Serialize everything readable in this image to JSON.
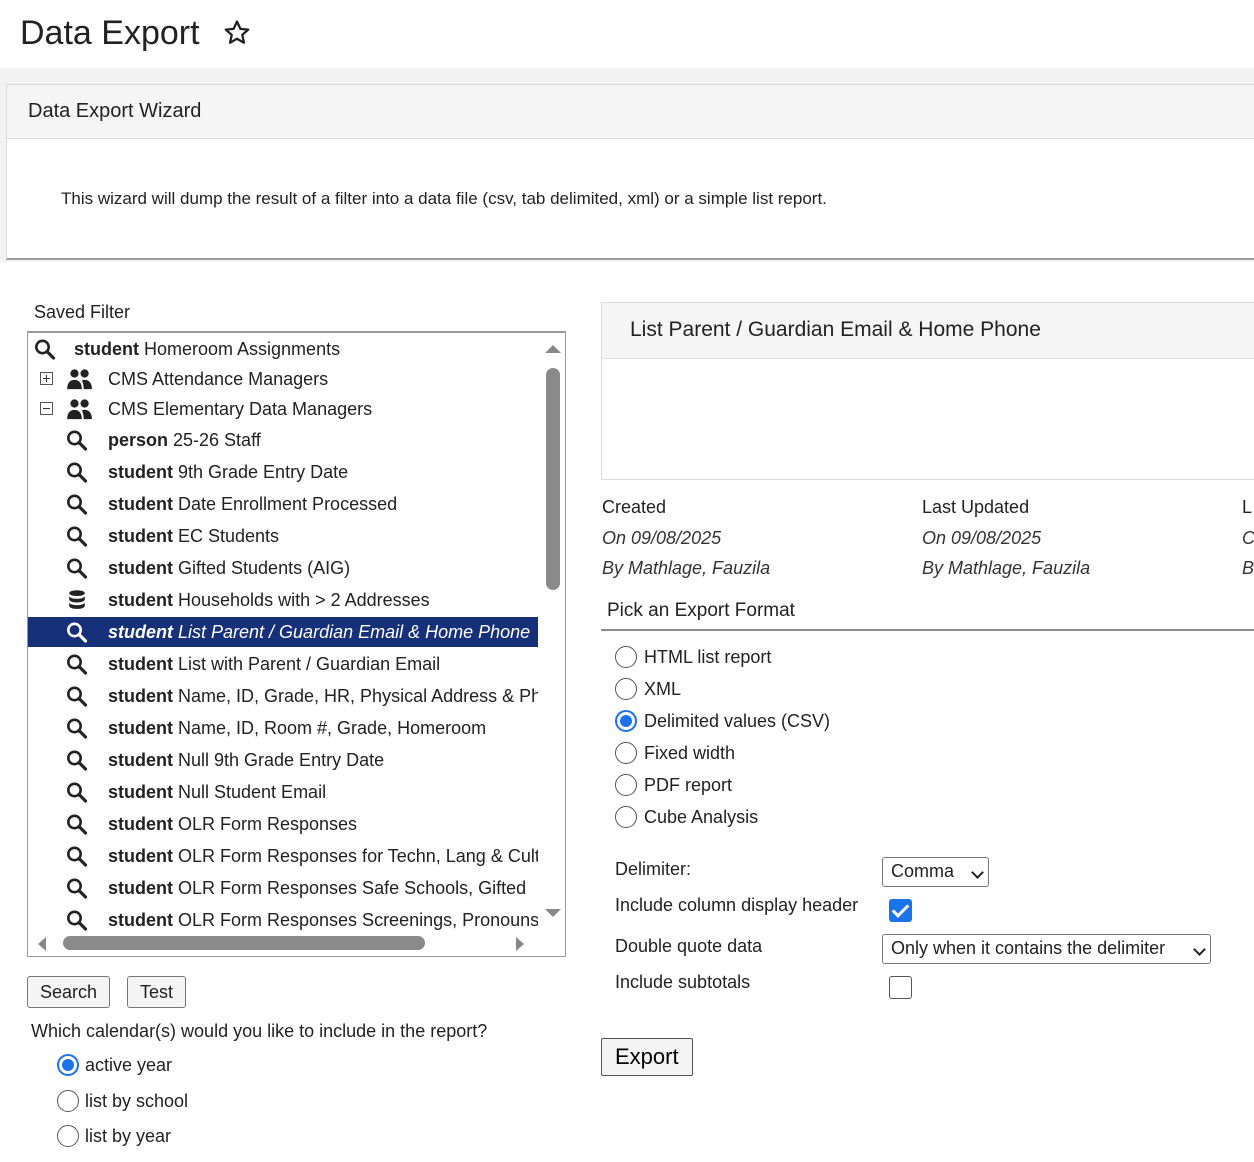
{
  "header": {
    "title": "Data Export"
  },
  "wizard": {
    "title": "Data Export Wizard",
    "description": "This wizard will dump the result of a filter into a data file (csv, tab delimited, xml) or a simple list report."
  },
  "saved_filter": {
    "label": "Saved Filter",
    "items": [
      {
        "prefix": "student",
        "name": " Homeroom Assignments",
        "icon": "search-icon"
      },
      {
        "prefix": "",
        "name": "CMS Attendance Managers",
        "icon": "users-icon",
        "expander": "plus"
      },
      {
        "prefix": "",
        "name": "CMS Elementary Data Managers",
        "icon": "users-icon",
        "expander": "minus"
      },
      {
        "prefix": "person",
        "name": " 25-26 Staff",
        "icon": "search-icon"
      },
      {
        "prefix": "student",
        "name": " 9th Grade Entry Date",
        "icon": "search-icon"
      },
      {
        "prefix": "student",
        "name": " Date Enrollment Processed",
        "icon": "search-icon"
      },
      {
        "prefix": "student",
        "name": " EC Students",
        "icon": "search-icon"
      },
      {
        "prefix": "student",
        "name": " Gifted Students (AIG)",
        "icon": "search-icon"
      },
      {
        "prefix": "student",
        "name": " Households with > 2 Addresses",
        "icon": "database-icon"
      },
      {
        "prefix": "student",
        "name": " List Parent / Guardian Email & Home Phone",
        "icon": "search-icon",
        "selected": true
      },
      {
        "prefix": "student",
        "name": " List with Parent / Guardian Email",
        "icon": "search-icon"
      },
      {
        "prefix": "student",
        "name": " Name, ID, Grade, HR, Physical Address & Phone",
        "icon": "search-icon"
      },
      {
        "prefix": "student",
        "name": " Name, ID, Room #, Grade, Homeroom",
        "icon": "search-icon"
      },
      {
        "prefix": "student",
        "name": " Null 9th Grade Entry Date",
        "icon": "search-icon"
      },
      {
        "prefix": "student",
        "name": " Null Student Email",
        "icon": "search-icon"
      },
      {
        "prefix": "student",
        "name": " OLR Form Responses",
        "icon": "search-icon"
      },
      {
        "prefix": "student",
        "name": " OLR Form Responses for Techn, Lang & Cultural",
        "icon": "search-icon"
      },
      {
        "prefix": "student",
        "name": " OLR Form Responses Safe Schools, Gifted",
        "icon": "search-icon"
      },
      {
        "prefix": "student",
        "name": " OLR Form Responses Screenings, Pronouns",
        "icon": "search-icon"
      }
    ]
  },
  "buttons": {
    "search": "Search",
    "test": "Test",
    "export": "Export"
  },
  "calendar": {
    "question": "Which calendar(s) would you like to include in the report?",
    "options": [
      "active year",
      "list by school",
      "list by year"
    ],
    "selected": "active year"
  },
  "detail": {
    "title": "List Parent / Guardian Email & Home Phone",
    "created_label": "Created",
    "created_on": "On 09/08/2025",
    "created_by": "By Mathlage, Fauzila",
    "updated_label": "Last Updated",
    "updated_on": "On 09/08/2025",
    "updated_by": "By Mathlage, Fauzila",
    "col3_label": "L",
    "col3_on": "C",
    "col3_by": "B"
  },
  "export_format": {
    "label": "Pick an Export Format",
    "options": [
      "HTML list report",
      "XML",
      "Delimited values (CSV)",
      "Fixed width",
      "PDF report",
      "Cube Analysis"
    ],
    "selected": "Delimited values (CSV)"
  },
  "options": {
    "delimiter_label": "Delimiter:",
    "delimiter_value": "Comma",
    "header_label": "Include column display header",
    "header_checked": true,
    "quote_label": "Double quote data",
    "quote_value": "Only when it contains the delimiter",
    "subtotals_label": "Include subtotals",
    "subtotals_checked": false
  },
  "colors": {
    "accent": "#1a73e8",
    "selection": "#17307a"
  }
}
